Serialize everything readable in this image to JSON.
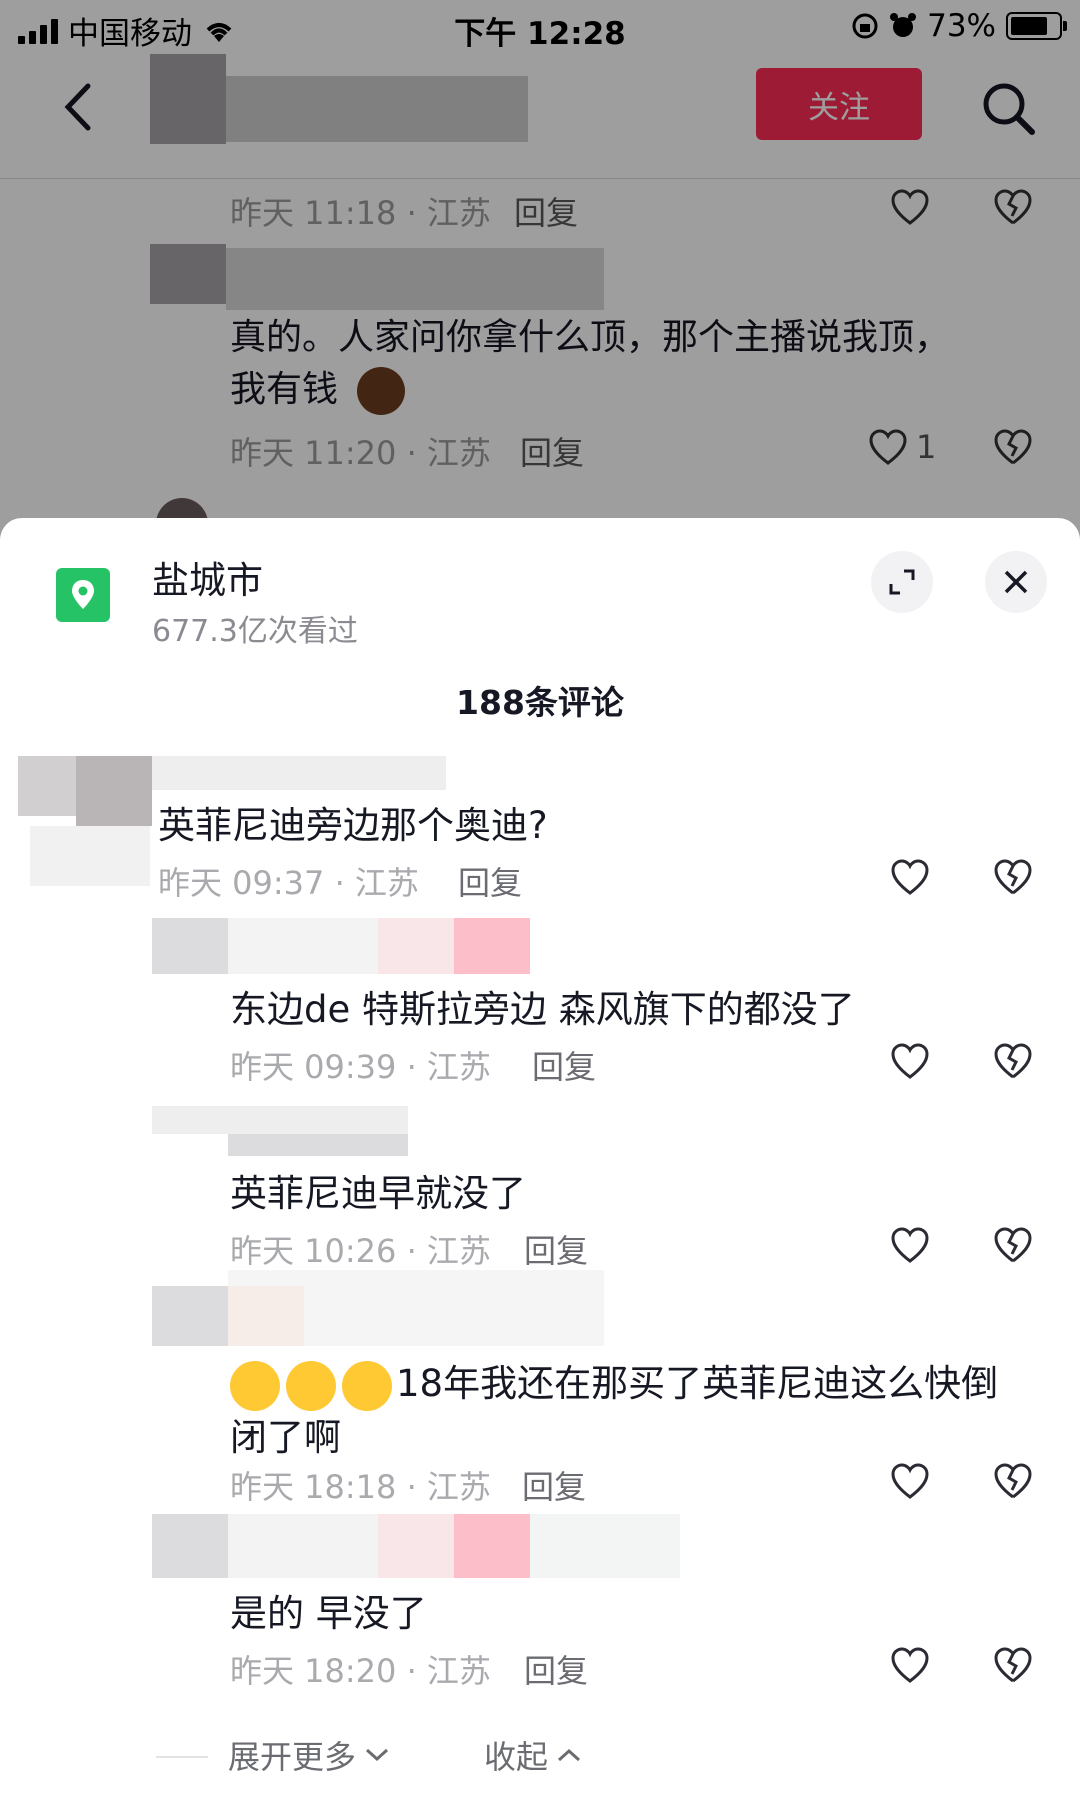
{
  "status_bar": {
    "carrier": "中国移动",
    "time": "下午 12:28",
    "battery": "73%"
  },
  "header": {
    "follow_label": "关注"
  },
  "background_comments": [
    {
      "meta": "昨天 11:18 · 江苏",
      "reply_label": "回复"
    },
    {
      "text_line1": "真的。人家问你拿什么顶，那个主播说我顶，",
      "text_line2": "我有钱",
      "meta": "昨天 11:20 · 江苏",
      "reply_label": "回复",
      "like_count": "1"
    }
  ],
  "sheet": {
    "location_name": "盐城市",
    "views": "677.3亿次看过",
    "comment_count": "188条评论"
  },
  "comments": [
    {
      "text": "英菲尼迪旁边那个奥迪?",
      "meta": "昨天 09:37 · 江苏",
      "reply_label": "回复"
    },
    {
      "text": "东边de 特斯拉旁边 森风旗下的都没了",
      "meta": "昨天 09:39 · 江苏",
      "reply_label": "回复"
    },
    {
      "text": "英菲尼迪早就没了",
      "meta": "昨天 10:26 · 江苏",
      "reply_label": "回复"
    },
    {
      "text_line1": "18年我还在那买了英菲尼迪这么快倒",
      "text_line2": "闭了啊",
      "meta": "昨天 18:18 · 江苏",
      "reply_label": "回复"
    },
    {
      "text": "是的 早没了",
      "meta": "昨天 18:20 · 江苏",
      "reply_label": "回复"
    }
  ],
  "footer": {
    "expand_label": "展开更多",
    "collapse_label": "收起"
  },
  "colors": {
    "accent": "#fe2c55",
    "location_icon": "#25c266"
  }
}
